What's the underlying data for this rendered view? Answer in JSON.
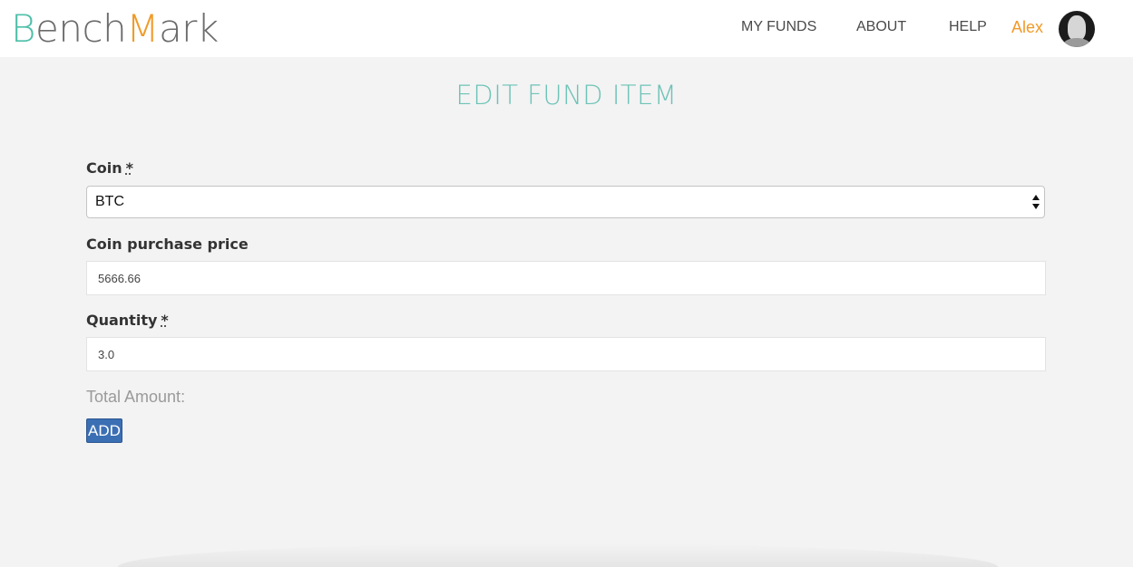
{
  "header": {
    "logo": {
      "part1": "B",
      "part2": "ench",
      "part3": "M",
      "part4": "ark"
    },
    "nav": {
      "my_funds": "MY FUNDS",
      "about": "ABOUT",
      "help": "HELP"
    },
    "user": {
      "name": "Alex"
    }
  },
  "form": {
    "title": "EDIT FUND ITEM",
    "coin": {
      "label": "Coin",
      "required_mark": "*",
      "selected": "BTC"
    },
    "purchase_price": {
      "label": "Coin purchase price",
      "value": "5666.66"
    },
    "quantity": {
      "label": "Quantity",
      "required_mark": "*",
      "value": "3.0"
    },
    "total_label": "Total Amount:",
    "submit_label": "ADD"
  },
  "colors": {
    "brand_teal": "#4ebfa9",
    "brand_orange": "#f09b2a",
    "button_blue": "#3b6fb4",
    "background": "#f3f3f3"
  }
}
